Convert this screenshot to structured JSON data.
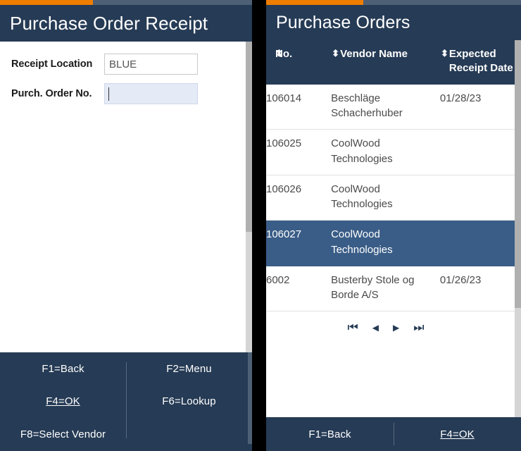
{
  "left_panel": {
    "progress_percent": 37,
    "title": "Purchase Order Receipt",
    "form": {
      "rows": [
        {
          "label": "Receipt Location",
          "value": "BLUE",
          "focused": false
        },
        {
          "label": "Purch. Order No.",
          "value": "",
          "focused": true
        }
      ]
    },
    "function_keys": [
      {
        "label": "F1=Back",
        "active": false
      },
      {
        "label": "F2=Menu",
        "active": false
      },
      {
        "label": "F4=OK",
        "active": true
      },
      {
        "label": "F6=Lookup",
        "active": false
      },
      {
        "label": "F8=Select Vendor",
        "active": false
      }
    ]
  },
  "right_panel": {
    "progress_percent": 38,
    "title": "Purchase Orders",
    "table": {
      "sort_icon": "⬍",
      "columns": [
        "No.",
        "Vendor Name",
        "Expected Receipt Date"
      ],
      "rows": [
        {
          "no": "106014",
          "vendor": "Beschläge Schacherhuber",
          "date": "01/28/23",
          "selected": false
        },
        {
          "no": "106025",
          "vendor": "CoolWood Technologies",
          "date": "",
          "selected": false
        },
        {
          "no": "106026",
          "vendor": "CoolWood Technologies",
          "date": "",
          "selected": false
        },
        {
          "no": "106027",
          "vendor": "CoolWood Technologies",
          "date": "",
          "selected": true
        },
        {
          "no": "6002",
          "vendor": "Busterby Stole og Borde A/S",
          "date": "01/26/23",
          "selected": false
        }
      ]
    },
    "pagination": {
      "first": "⏮",
      "prev": "◀",
      "next": "▶",
      "last": "⏭"
    },
    "function_keys": [
      {
        "label": "F1=Back",
        "active": false
      },
      {
        "label": "F4=OK",
        "active": true
      }
    ]
  },
  "colors": {
    "header_navy": "#263b55",
    "accent_orange": "#ef7d00",
    "row_selected": "#3a5d87",
    "focus_field": "#e4eaf6"
  }
}
